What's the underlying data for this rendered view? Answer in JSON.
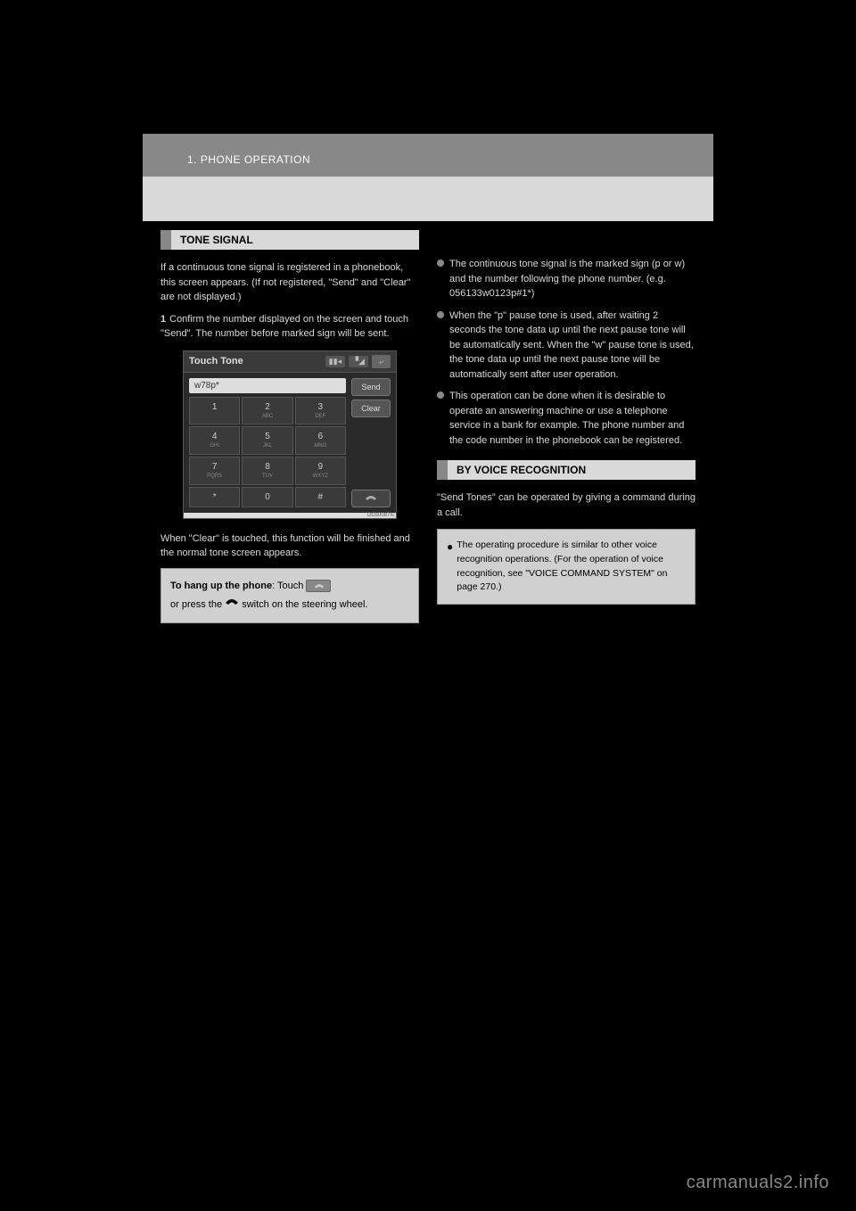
{
  "header": {
    "breadcrumb": "1. PHONE OPERATION"
  },
  "left": {
    "section_title": "TONE SIGNAL",
    "intro_1": "If a continuous tone signal is registered in a phonebook, this screen appears. (If not registered, \"Send\" and \"Clear\" are not displayed.)",
    "intro_2": "Confirm the number displayed on the screen and touch \"Send\". The number before marked sign will be sent.",
    "touch_tone": {
      "title": "Touch Tone",
      "display_value": "w78p*",
      "keys": [
        {
          "num": "1",
          "letters": ""
        },
        {
          "num": "2",
          "letters": "ABC"
        },
        {
          "num": "3",
          "letters": "DEF"
        },
        {
          "num": "4",
          "letters": "GHI"
        },
        {
          "num": "5",
          "letters": "JKL"
        },
        {
          "num": "6",
          "letters": "MNO"
        },
        {
          "num": "7",
          "letters": "PQRS"
        },
        {
          "num": "8",
          "letters": "TUV"
        },
        {
          "num": "9",
          "letters": "WXYZ"
        },
        {
          "num": "*",
          "letters": ""
        },
        {
          "num": "0",
          "letters": ""
        },
        {
          "num": "#",
          "letters": ""
        }
      ],
      "send_label": "Send",
      "clear_label": "Clear",
      "back_icon": "⤶",
      "img_code": "DGs0087Is"
    },
    "after_screen": "When \"Clear\" is touched, this function will be finished and the normal tone screen appears.",
    "hangup": {
      "prefix": "To hang up the phone",
      "text1": ": Touch ",
      "text2": "or press the ",
      "text3": " switch on the steering wheel."
    }
  },
  "right": {
    "bullets": [
      "The continuous tone signal is the marked sign (p or w) and the number following the phone number. (e.g. 056133w0123p#1*)",
      "When the \"p\" pause tone is used, after waiting 2 seconds the tone data up until the next pause tone will be automatically sent. When the \"w\" pause tone is used, the tone data up until the next pause tone will be automatically sent after user operation.",
      "This operation can be done when it is desirable to operate an answering machine or use a telephone service in a bank for example. The phone number and the code number in the phonebook can be registered."
    ],
    "section_title": "BY VOICE RECOGNITION",
    "pre_voice": "\"Send Tones\" can be operated by giving a command during a call.",
    "voice_note": "The operating procedure is similar to other voice recognition operations. (For the operation of voice recognition, see \"VOICE COMMAND SYSTEM\" on page 270.)"
  },
  "watermark": "carmanuals2.info"
}
